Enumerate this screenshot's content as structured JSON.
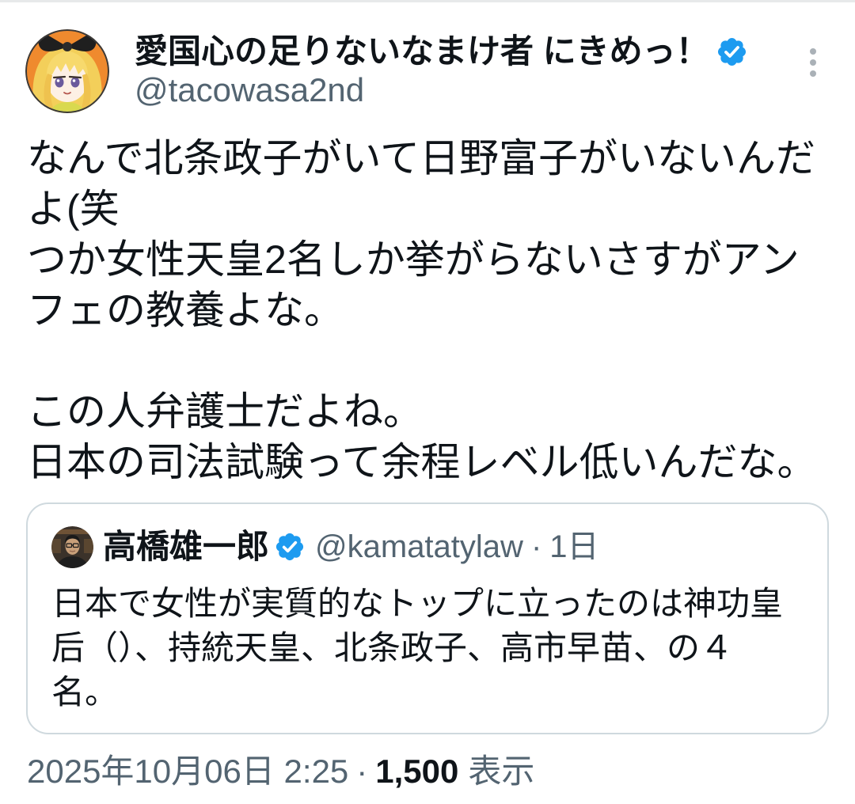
{
  "post": {
    "author": {
      "display_name": "愛国心の足りないなまけ者 にきめっ！",
      "handle": "@tacowasa2nd",
      "verified": true,
      "avatar_icon": "anime-girl-avatar-icon",
      "verified_icon": "verified-badge-icon"
    },
    "more_icon": "more-vertical-icon",
    "text_blocks": [
      {
        "lines": [
          "なんで北条政子がいて日野富子がいないんだ",
          "よ(笑",
          "つか女性天皇2名しか挙がらないさすがアン",
          "フェの教養よな。"
        ]
      },
      {
        "lines": [
          "この人弁護士だよね。",
          "日本の司法試験って余程レベル低いんだな。"
        ]
      }
    ],
    "quoted": {
      "author": {
        "display_name": "高橋雄一郎",
        "handle": "@kamatatylaw",
        "verified": true,
        "avatar_icon": "man-with-glasses-avatar-icon",
        "verified_icon": "verified-badge-icon"
      },
      "separator": "·",
      "time": "1日",
      "text_lines": [
        "日本で女性が実質的なトップに立ったのは神功皇",
        "后（）、持統天皇、北条政子、高市早苗、の４",
        "名。"
      ]
    },
    "meta": {
      "timestamp": "2025年10月06日 2:25",
      "separator": "·",
      "views_count": "1,500",
      "views_label": "表示"
    }
  },
  "colors": {
    "background": "#ffffff",
    "text": "#0f1419",
    "muted": "#536471",
    "verified": "#1d9bf0",
    "border": "#cfd9de",
    "divider": "#e7e9ea",
    "icon": "#aab1b7"
  }
}
